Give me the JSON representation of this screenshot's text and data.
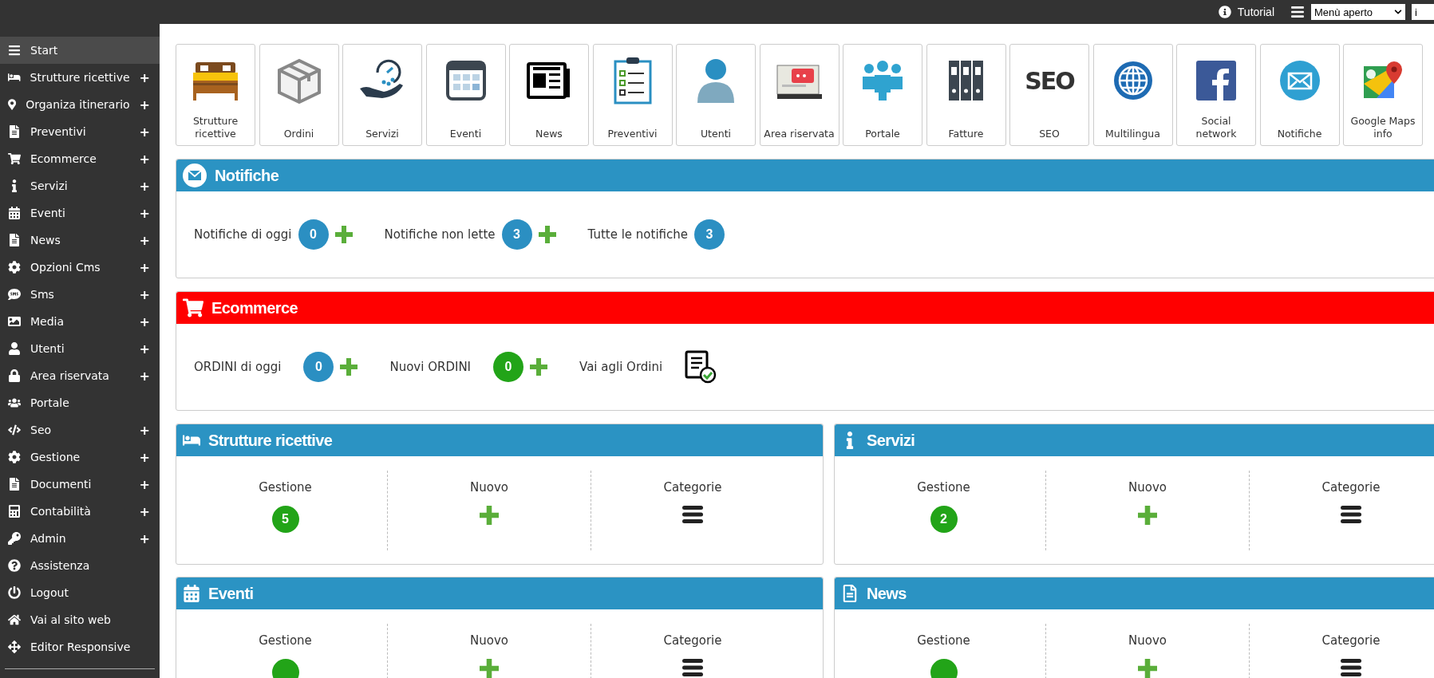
{
  "topbar": {
    "tutorial": "Tutorial",
    "menu_select": "Menù aperto",
    "language_select": "i"
  },
  "sidebar": {
    "items": [
      {
        "label": "Start",
        "selected": true
      },
      {
        "label": "Strutture ricettive",
        "toggle": "+",
        "selected": false
      },
      {
        "label": "Organiza itinerario",
        "toggle": "+",
        "selected": false
      },
      {
        "label": "Preventivi",
        "toggle": "+",
        "selected": false
      },
      {
        "label": "Ecommerce",
        "toggle": "+",
        "selected": false
      },
      {
        "label": "Servizi",
        "toggle": "+",
        "selected": false
      },
      {
        "label": "Eventi",
        "toggle": "+",
        "selected": false
      },
      {
        "label": "News",
        "toggle": "+",
        "selected": false
      },
      {
        "label": "Opzioni Cms",
        "toggle": "+",
        "selected": false
      },
      {
        "label": "Sms",
        "toggle": "+",
        "selected": false
      },
      {
        "label": "Media",
        "toggle": "+",
        "selected": false
      },
      {
        "label": "Utenti",
        "toggle": "+",
        "selected": false
      },
      {
        "label": "Area riservata",
        "toggle": "+",
        "selected": false
      },
      {
        "label": "Portale",
        "selected": false
      },
      {
        "label": "Seo",
        "toggle": "+",
        "selected": false
      },
      {
        "label": "Gestione",
        "toggle": "+",
        "selected": false
      },
      {
        "label": "Documenti",
        "toggle": "+",
        "selected": false
      },
      {
        "label": "Contabilità",
        "toggle": "+",
        "selected": false
      },
      {
        "label": "Admin",
        "toggle": "+",
        "selected": false
      },
      {
        "label": "Assistenza",
        "selected": false
      },
      {
        "label": "Logout",
        "selected": false
      },
      {
        "label": "Vai al sito web",
        "selected": false
      },
      {
        "label": "Editor Responsive",
        "selected": false
      }
    ]
  },
  "tiles": [
    {
      "label": "Strutture ricettive"
    },
    {
      "label": "Ordini"
    },
    {
      "label": "Servizi"
    },
    {
      "label": "Eventi"
    },
    {
      "label": "News"
    },
    {
      "label": "Preventivi"
    },
    {
      "label": "Utenti"
    },
    {
      "label": "Area riservata"
    },
    {
      "label": "Portale"
    },
    {
      "label": "Fatture"
    },
    {
      "label": "SEO",
      "icon_text": "SEO"
    },
    {
      "label": "Multilingua"
    },
    {
      "label": "Social network"
    },
    {
      "label": "Notifiche"
    },
    {
      "label": "Google Maps info"
    }
  ],
  "panels": [
    {
      "title": "Notifiche",
      "color": "#2b93c3",
      "stats": [
        {
          "kind": "count_add",
          "label": "Notifiche di oggi",
          "count": "0",
          "color": "#2b8fc2"
        },
        {
          "kind": "count_add",
          "label": "Notifiche non lette",
          "count": "3",
          "color": "#2b8fc2"
        },
        {
          "kind": "count",
          "label": "Tutte le notifiche",
          "count": "3",
          "color": "#2b8fc2"
        }
      ]
    },
    {
      "title": "Ecommerce",
      "color": "#ff0000",
      "stats": [
        {
          "kind": "count_add",
          "label": "ORDINI di oggi",
          "count": "0",
          "color": "#2b8fc2"
        },
        {
          "kind": "count_add",
          "label": "Nuovi ORDINI",
          "count": "0",
          "color": "#22a418"
        },
        {
          "kind": "link",
          "label": "Vai agli Ordini"
        }
      ]
    }
  ],
  "modules": [
    {
      "title": "Strutture ricettive",
      "actions": [
        {
          "kind": "count",
          "label": "Gestione",
          "count": "5"
        },
        {
          "kind": "add",
          "label": "Nuovo"
        },
        {
          "kind": "list",
          "label": "Categorie"
        }
      ]
    },
    {
      "title": "Servizi",
      "actions": [
        {
          "kind": "count",
          "label": "Gestione",
          "count": "2"
        },
        {
          "kind": "add",
          "label": "Nuovo"
        },
        {
          "kind": "list",
          "label": "Categorie"
        }
      ]
    },
    {
      "title": "Eventi",
      "actions": [
        {
          "kind": "count",
          "label": "Gestione"
        },
        {
          "kind": "add",
          "label": "Nuovo"
        },
        {
          "kind": "list",
          "label": "Categorie"
        }
      ]
    },
    {
      "title": "News",
      "actions": [
        {
          "kind": "count",
          "label": "Gestione"
        },
        {
          "kind": "add",
          "label": "Nuovo"
        },
        {
          "kind": "list",
          "label": "Categorie"
        }
      ]
    }
  ]
}
